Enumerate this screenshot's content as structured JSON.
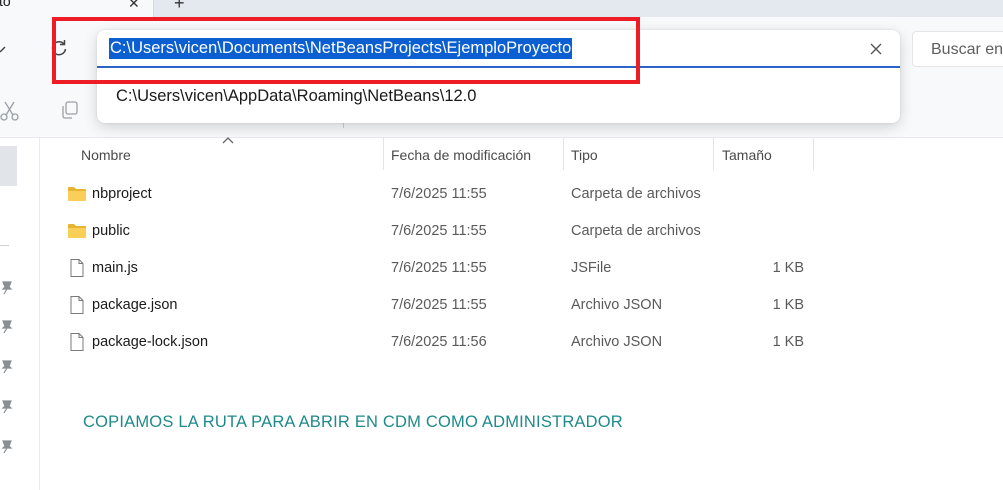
{
  "tab": {
    "title": "to"
  },
  "address_bar": {
    "value": "C:\\Users\\vicen\\Documents\\NetBeansProjects\\EjemploProyecto",
    "suggestion": "C:\\Users\\vicen\\AppData\\Roaming\\NetBeans\\12.0"
  },
  "search": {
    "placeholder": "Buscar en"
  },
  "columns": [
    {
      "label": "Nombre"
    },
    {
      "label": "Fecha de modificación"
    },
    {
      "label": "Tipo"
    },
    {
      "label": "Tamaño"
    }
  ],
  "files": [
    {
      "name": "nbproject",
      "date": "7/6/2025 11:55",
      "type": "Carpeta de archivos",
      "size": "",
      "icon": "folder-icon"
    },
    {
      "name": "public",
      "date": "7/6/2025 11:55",
      "type": "Carpeta de archivos",
      "size": "",
      "icon": "folder-icon"
    },
    {
      "name": "main.js",
      "date": "7/6/2025 11:55",
      "type": "JSFile",
      "size": "1 KB",
      "icon": "file-icon"
    },
    {
      "name": "package.json",
      "date": "7/6/2025 11:55",
      "type": "Archivo JSON",
      "size": "1 KB",
      "icon": "file-icon"
    },
    {
      "name": "package-lock.json",
      "date": "7/6/2025 11:56",
      "type": "Archivo JSON",
      "size": "1 KB",
      "icon": "file-icon"
    }
  ],
  "annotation": "COPIAMOS LA RUTA PARA ABRIR EN CDM COMO ADMINISTRADOR",
  "colors": {
    "selection": "#0b5fd1",
    "highlight_border": "#ee1c25",
    "annotation_text": "#1f8a8a",
    "folder": "#f4c542"
  }
}
